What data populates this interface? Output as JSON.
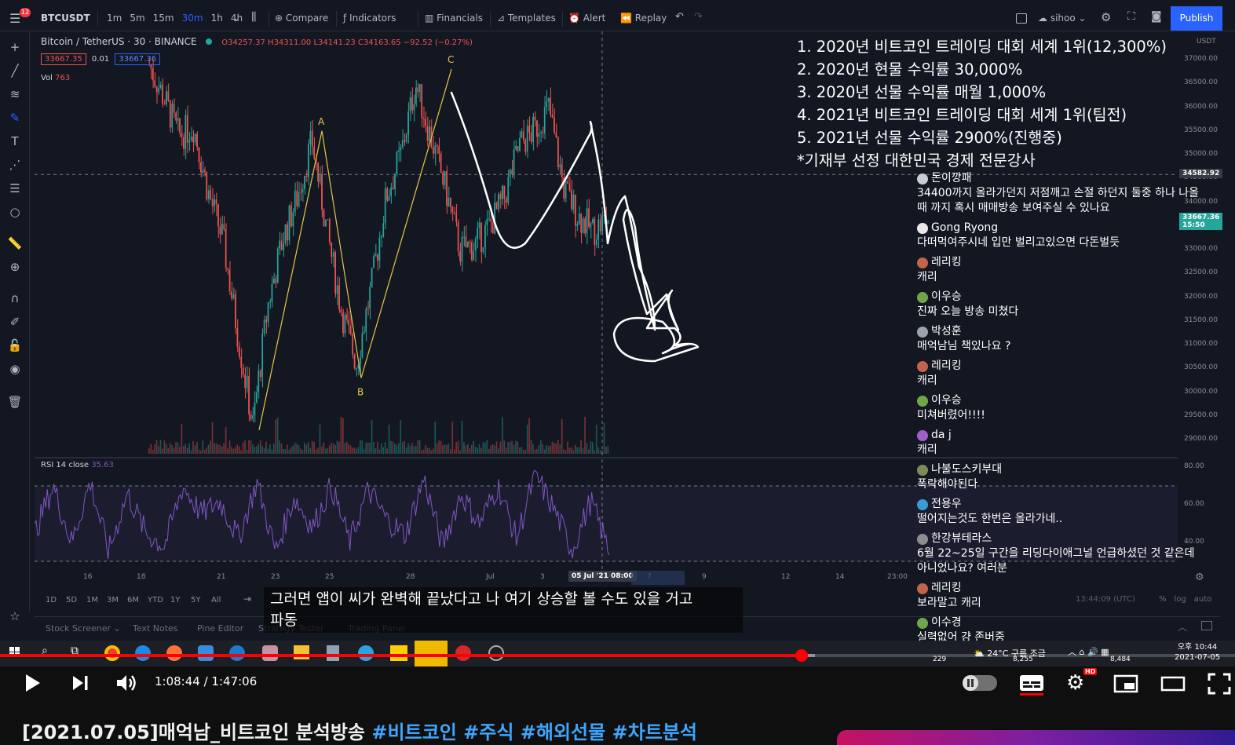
{
  "colors": {
    "accent": "#2962ff",
    "up": "#26a69a",
    "down": "#ef5350",
    "rsi": "#7e57c2",
    "annotation": "#ffffff",
    "wave": "#e6c64a",
    "progress": "#ff0000",
    "hashtag": "#3ea6ff"
  },
  "tradingview": {
    "notif_count": "12",
    "symbol": "BTCUSDT",
    "intervals": [
      "1m",
      "5m",
      "15m",
      "30m",
      "1h",
      "4h"
    ],
    "active_interval": "30m",
    "compare": "Compare",
    "indicators": "Indicators",
    "financials": "Financials",
    "templates": "Templates",
    "alert": "Alert",
    "replay": "Replay",
    "user": "sihoo",
    "publish": "Publish",
    "legend_symbol": "Bitcoin / TetherUS",
    "legend_interval": "30",
    "legend_exchange": "BINANCE",
    "ohlc": "O34257.37 H34311.00 L34141.23 C34163.65 −92.52 (−0.27%)",
    "bid": "33667.35",
    "spread": "0.01",
    "ask": "33667.36",
    "vol_label": "Vol",
    "vol_value": "763",
    "rsi_label": "RSI 14 close",
    "rsi_value": "35.63",
    "price_ticks": [
      "37000.00",
      "36500.00",
      "36000.00",
      "35500.00",
      "35000.00",
      "34500.00",
      "34000.00",
      "33500.00",
      "33000.00",
      "32500.00",
      "32000.00",
      "31500.00",
      "31000.00",
      "30500.00",
      "30000.00",
      "29500.00",
      "29000.00"
    ],
    "price_top": "USDT",
    "crosshair_price": "34582.92",
    "last_price": "33667.36",
    "last_time": "15:50",
    "rsi_ticks": [
      "80.00",
      "60.00",
      "40.00"
    ],
    "time_ticks": [
      "16",
      "18",
      "21",
      "23",
      "25",
      "28",
      "Jul",
      "3",
      "7",
      "9",
      "12",
      "14",
      "23:00"
    ],
    "crosshair_time": "05 Jul '21  08:00",
    "ranges": [
      "1D",
      "5D",
      "1M",
      "3M",
      "6M",
      "YTD",
      "1Y",
      "5Y",
      "All"
    ],
    "clock": "13:44:09 (UTC)",
    "scale_opts": [
      "%",
      "log",
      "auto"
    ],
    "panels": [
      "Stock Screener",
      "Text Notes",
      "Pine Editor",
      "Strategy Tester",
      "Trading Panel"
    ],
    "wave_labels": [
      "A",
      "B",
      "C"
    ]
  },
  "chart_data": {
    "type": "candlestick",
    "symbol": "BTCUSDT",
    "interval": "30m",
    "x_labels": [
      "16",
      "18",
      "21",
      "23",
      "25",
      "28",
      "Jul",
      "3",
      "05 Jul '21 08:00"
    ],
    "price_range": [
      29000,
      37200
    ],
    "close": [
      36900,
      36200,
      35400,
      35600,
      34200,
      33200,
      31200,
      29300,
      31800,
      33200,
      34100,
      35300,
      33400,
      31700,
      30600,
      32200,
      34100,
      35000,
      36500,
      35400,
      34300,
      33000,
      33100,
      33500,
      34100,
      35200,
      35500,
      36000,
      34300,
      33700,
      33400,
      33667
    ],
    "rsi_range": [
      30,
      80
    ],
    "rsi": [
      45,
      70,
      40,
      72,
      35,
      66,
      45,
      38,
      70,
      55,
      62,
      42,
      72,
      35,
      64,
      48,
      70,
      40,
      68,
      52,
      44,
      74,
      38,
      66,
      50,
      70,
      42,
      76,
      58,
      36,
      62,
      35.63
    ],
    "annotations": {
      "wave": [
        {
          "label": "A",
          "price": 35500
        },
        {
          "label": "B",
          "price": 30300
        },
        {
          "label": "C",
          "price": 36800
        }
      ],
      "drawn_path_note": "handwritten projection",
      "crosshair_price": 34582.92,
      "last_price": 33667.36
    }
  },
  "overlay": {
    "lines": [
      "1. 2020년 비트코인 트레이딩 대회 세계 1위(12,300%)",
      "2. 2020년 현물 수익률 30,000%",
      "3. 2020년 선물 수익률 매월 1,000%",
      "4. 2021년 비트코인 트레이딩 대회 세계 1위(팀전)",
      "5. 2021년 선물 수익률 2900%(진행중)",
      "*기재부 선정 대한민국 경제 전문강사"
    ]
  },
  "chat": [
    {
      "name": "돈이깡패",
      "text": "34400까지 올라가던지 저점깨고 손절 하던지 둘중 하나 나올때 까지 혹시 매매방송 보여주실 수 있나요",
      "avatar": "#c7cdd4"
    },
    {
      "name": "Gong Ryong",
      "text": "다떠먹여주시네 입만 벌리고있으면 다돈벌듯",
      "avatar": "#e8e8e8"
    },
    {
      "name": "레리킹",
      "text": "캐리",
      "avatar": "#c0644a"
    },
    {
      "name": "이우승",
      "text": "진짜 오늘 방송 미쳤다",
      "avatar": "#6fa64a"
    },
    {
      "name": "박성훈",
      "text": "매억남님 책있나요 ?",
      "avatar": "#9aa3ad"
    },
    {
      "name": "레리킹",
      "text": "캐리",
      "avatar": "#c0644a"
    },
    {
      "name": "이우승",
      "text": "미쳐버렸어!!!!",
      "avatar": "#6fa64a"
    },
    {
      "name": "da j",
      "text": "캐리",
      "avatar": "#a05ec9"
    },
    {
      "name": "나불도스키부대",
      "text": "폭락해야된다",
      "avatar": "#7d8b5a"
    },
    {
      "name": "전용우",
      "text": "떨어지는것도 한번은 올라가네..",
      "avatar": "#3a9bd6"
    },
    {
      "name": "한강뷰테라스",
      "text": "6월 22~25일 구간을 리딩다이애그널 언급하셨던 것 같은데 아니었나요? 여러분",
      "avatar": "#8d8d8d"
    },
    {
      "name": "레리킹",
      "text": "보라말고 캐리",
      "avatar": "#c0644a"
    },
    {
      "name": "이수경",
      "text": "실력없어 걍 존버중",
      "avatar": "#6fa64a"
    }
  ],
  "subtitle": {
    "line1": "그러면 앱이 씨가 완벽해 끝났다고 나 여기 상승할 볼 수도 있을 거고",
    "line2": "파동"
  },
  "taskbar": {
    "weather": "24°C 구름 조금",
    "time": "오후 10:44",
    "date": "2021-07-05",
    "count1": "229",
    "count2": "8,255",
    "count3": "8,484"
  },
  "player": {
    "time_current": "1:08:44",
    "time_sep": " / ",
    "time_total": "1:47:06",
    "progress_fraction": 0.649,
    "buffer_fraction": 0.66,
    "settings_badge": "HD"
  },
  "video_title": {
    "text": "[2021.07.05]매억남_비트코인 분석방송 ",
    "tags": [
      "#비트코인",
      "#주식",
      "#해외선물",
      "#차트분석"
    ]
  }
}
